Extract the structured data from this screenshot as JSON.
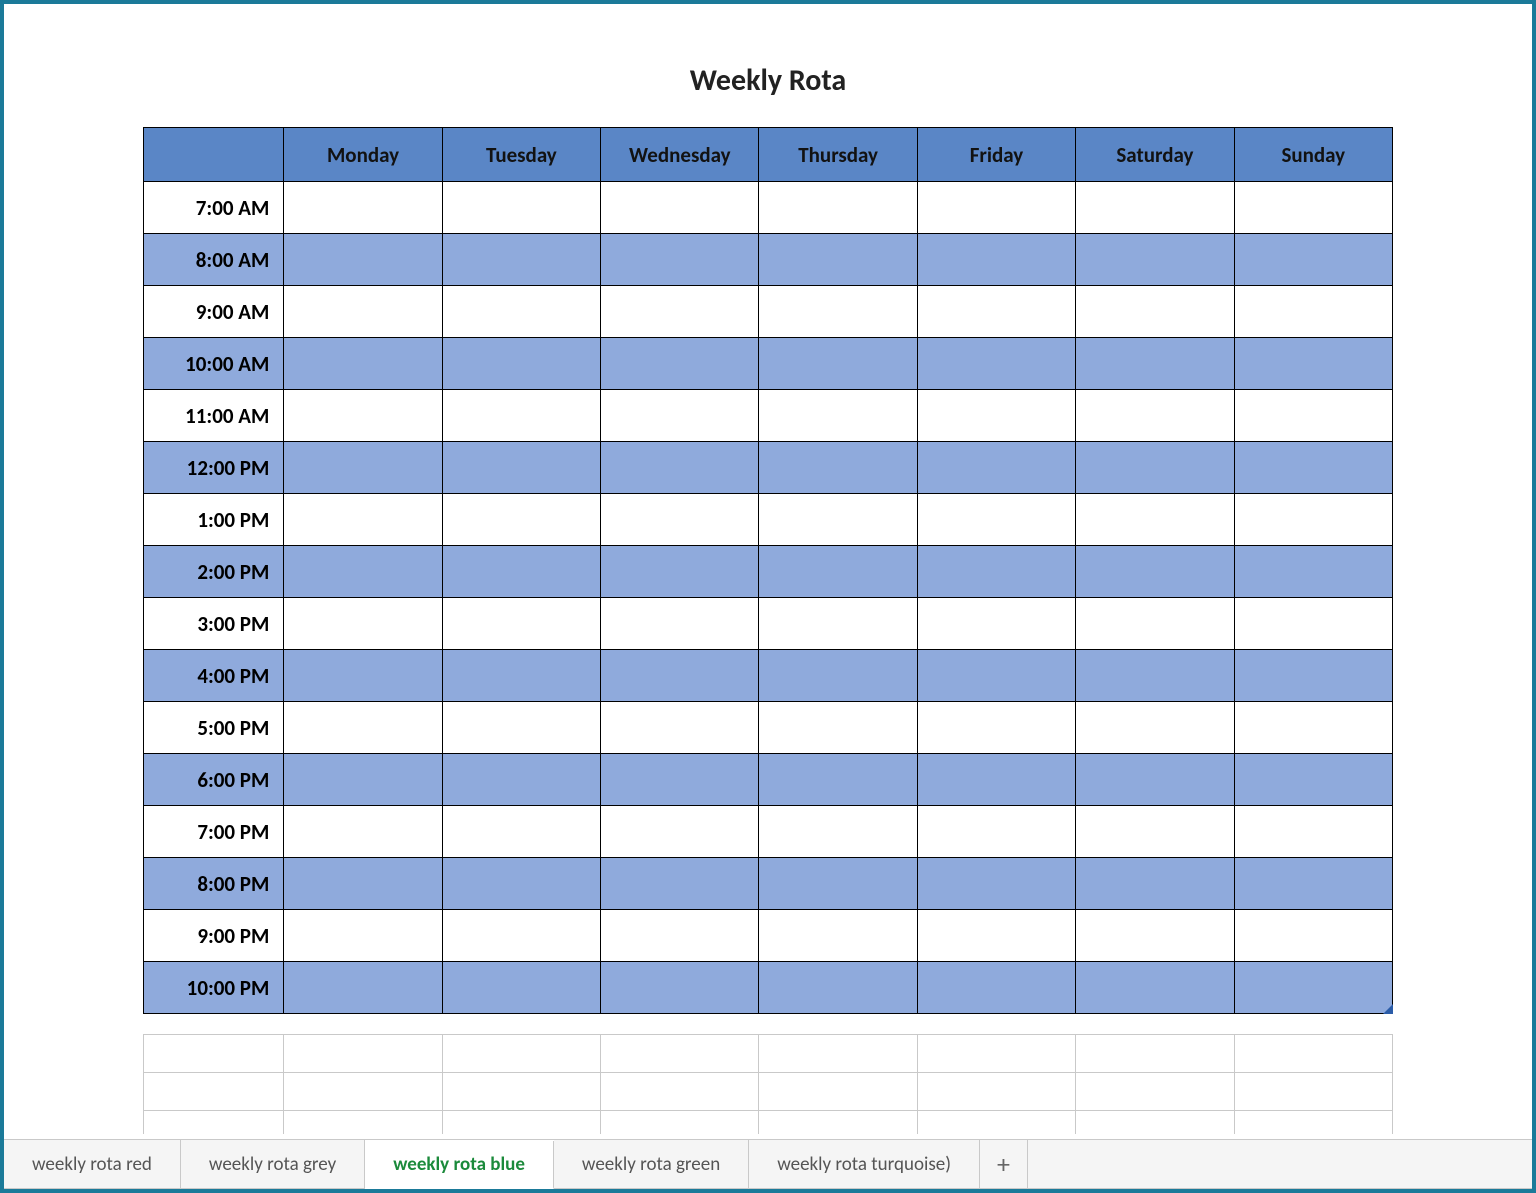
{
  "title": "Weekly Rota",
  "days": [
    "Monday",
    "Tuesday",
    "Wednesday",
    "Thursday",
    "Friday",
    "Saturday",
    "Sunday"
  ],
  "times": [
    "7:00 AM",
    "8:00 AM",
    "9:00 AM",
    "10:00 AM",
    "11:00 AM",
    "12:00 PM",
    "1:00 PM",
    "2:00 PM",
    "3:00 PM",
    "4:00 PM",
    "5:00 PM",
    "6:00 PM",
    "7:00 PM",
    "8:00 PM",
    "9:00 PM",
    "10:00 PM"
  ],
  "tabs": [
    {
      "label": "weekly rota red",
      "active": false
    },
    {
      "label": "weekly rota grey",
      "active": false
    },
    {
      "label": "weekly rota blue",
      "active": true
    },
    {
      "label": "weekly rota green",
      "active": false
    },
    {
      "label": "weekly rota turquoise)",
      "active": false
    }
  ],
  "new_sheet_glyph": "+",
  "colors": {
    "header_bg": "#5a86c6",
    "row_alt_bg": "#8faadc",
    "frame_border": "#1b7a99",
    "active_tab_text": "#1b8a3b"
  }
}
